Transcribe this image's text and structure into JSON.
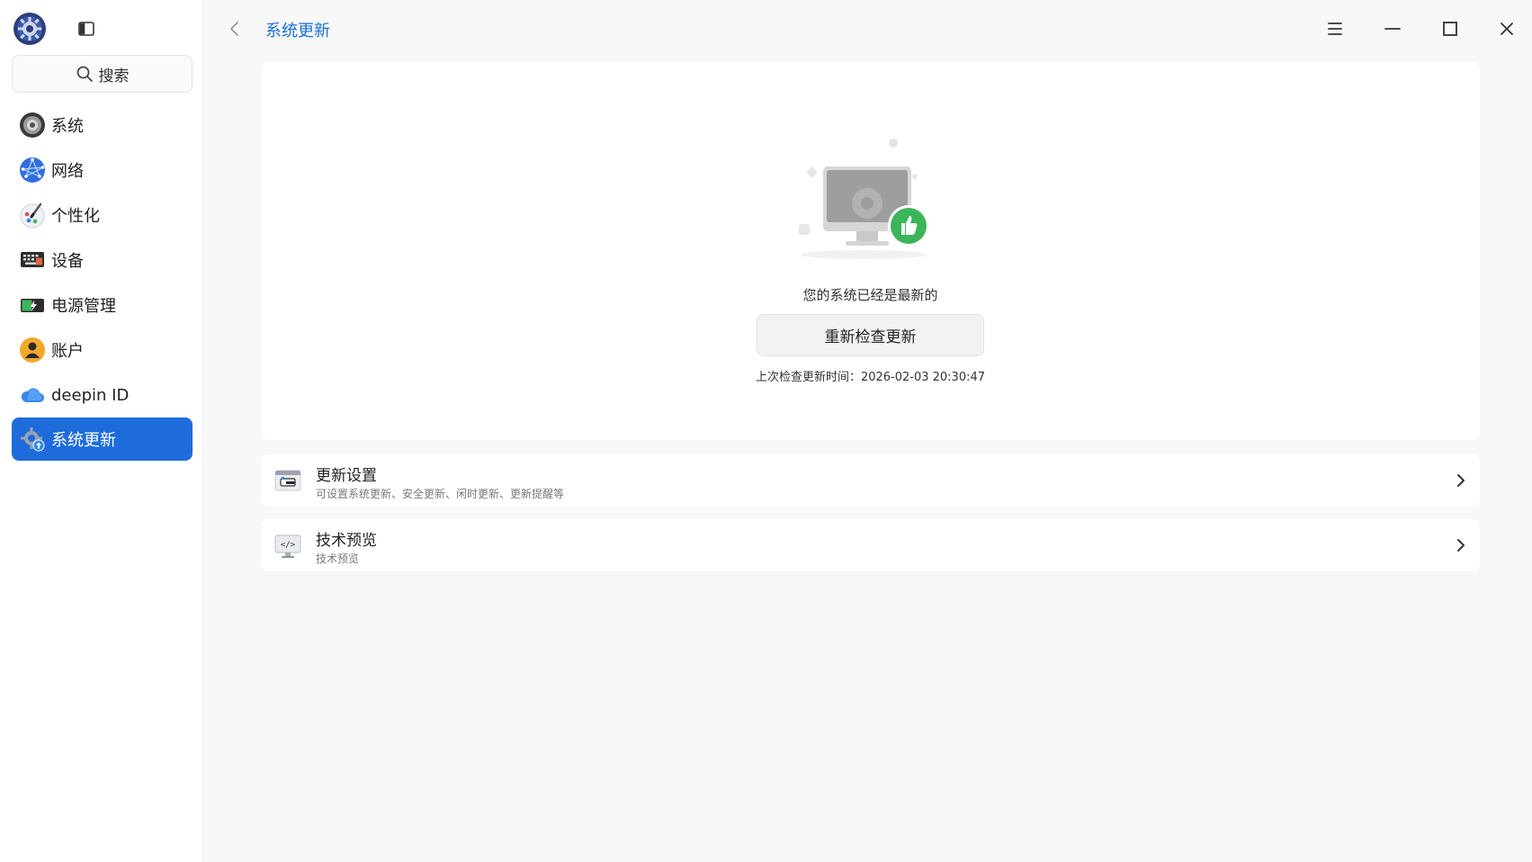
{
  "sidebar": {
    "search_label": "搜索",
    "items": [
      {
        "label": "系统",
        "icon": "system-icon",
        "active": false
      },
      {
        "label": "网络",
        "icon": "network-icon",
        "active": false
      },
      {
        "label": "个性化",
        "icon": "personalization-icon",
        "active": false
      },
      {
        "label": "设备",
        "icon": "devices-icon",
        "active": false
      },
      {
        "label": "电源管理",
        "icon": "power-icon",
        "active": false
      },
      {
        "label": "账户",
        "icon": "account-icon",
        "active": false
      },
      {
        "label": "deepin ID",
        "icon": "cloud-icon",
        "active": false
      },
      {
        "label": "系统更新",
        "icon": "system-update-icon",
        "active": true
      }
    ]
  },
  "header": {
    "title": "系统更新"
  },
  "main": {
    "status": "您的系统已经是最新的",
    "recheck_button": "重新检查更新",
    "last_check": "上次检查更新时间：2026-02-03 20:30:47",
    "rows": [
      {
        "title": "更新设置",
        "subtitle": "可设置系统更新、安全更新、闲时更新、更新提醒等",
        "icon": "update-settings-icon"
      },
      {
        "title": "技术预览",
        "subtitle": "技术预览",
        "icon": "tech-preview-icon"
      }
    ]
  },
  "colors": {
    "accent": "#1e6cdb",
    "title_blue": "#1a6ed8",
    "thumb_green": "#3cb55a"
  }
}
